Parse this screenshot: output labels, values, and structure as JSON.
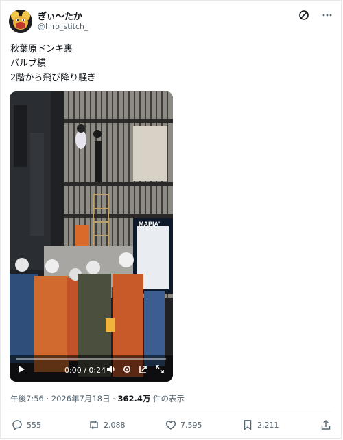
{
  "author": {
    "display_name": "ぎぃ〜たか",
    "handle": "@hiro_stitch_"
  },
  "post": {
    "lines": [
      "秋葉原ドンキ裏",
      "バルブ横",
      "2階から飛び降り騒ぎ"
    ]
  },
  "video": {
    "time": "0:00 / 0:24",
    "sign_text": "MAPIA'"
  },
  "meta": {
    "time": "午後7:56",
    "date": "2026年7月18日",
    "views": "362.4万",
    "views_suffix": "件の表示",
    "separator": "·"
  },
  "actions": {
    "replies": "555",
    "reposts": "2,088",
    "likes": "7,595",
    "bookmarks": "2,211"
  },
  "icons": [
    "grok-icon",
    "more-icon",
    "play-icon",
    "volume-icon",
    "settings-icon",
    "pip-icon",
    "fullscreen-icon",
    "reply-icon",
    "repost-icon",
    "like-icon",
    "bookmark-icon",
    "share-icon"
  ]
}
